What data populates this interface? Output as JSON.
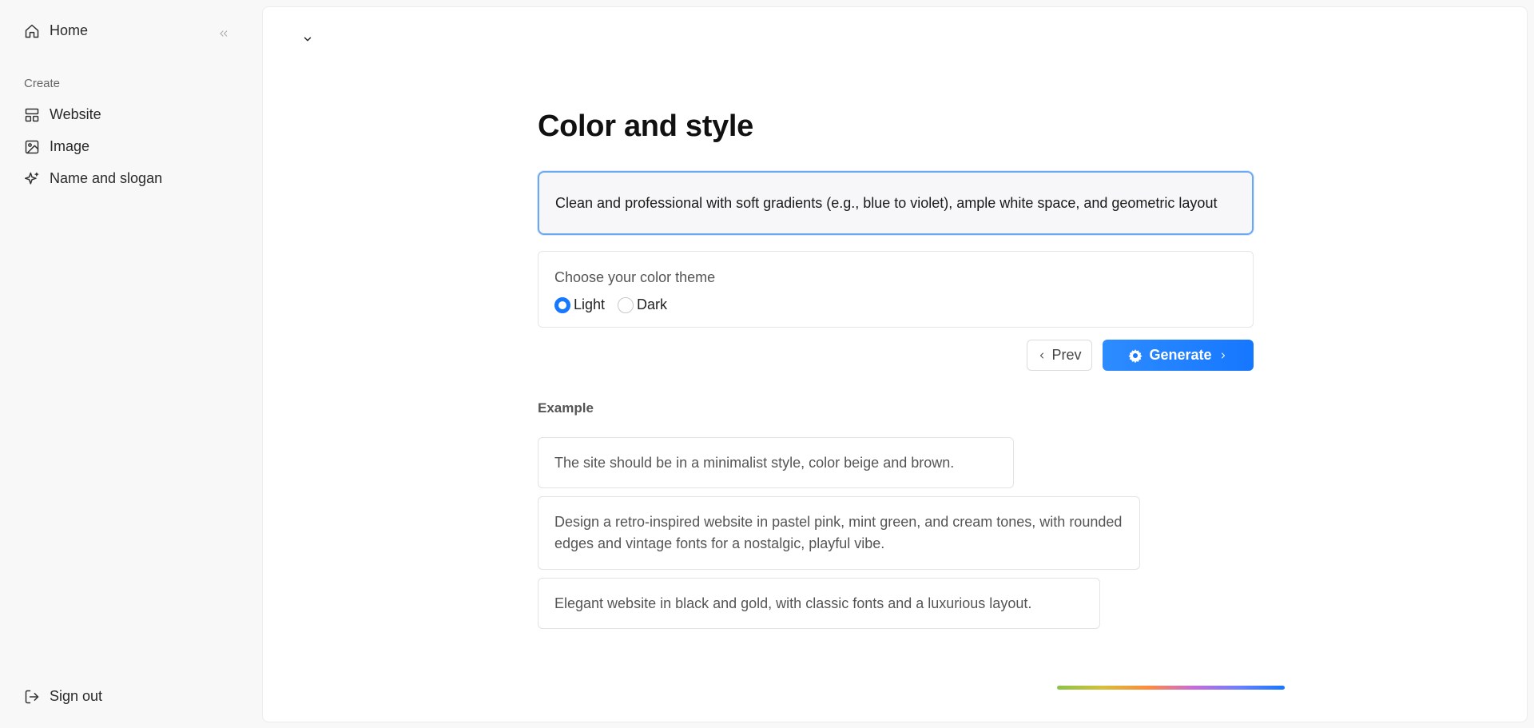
{
  "sidebar": {
    "home_label": "Home",
    "create_section_label": "Create",
    "items": [
      {
        "label": "Website",
        "icon": "layout-icon"
      },
      {
        "label": "Image",
        "icon": "image-icon"
      },
      {
        "label": "Name and slogan",
        "icon": "sparkles-icon"
      }
    ],
    "signout_label": "Sign out"
  },
  "main": {
    "title": "Color and style",
    "prompt_value": "Clean and professional with soft gradients (e.g., blue to violet), ample white space, and geometric layout",
    "theme": {
      "label": "Choose your color theme",
      "options": [
        "Light",
        "Dark"
      ],
      "selected": "Light"
    },
    "prev_label": "Prev",
    "generate_label": "Generate",
    "example_label": "Example",
    "examples": [
      "The site should be in a minimalist style, color beige and brown.",
      "Design a retro-inspired website in pastel pink, mint green, and cream tones, with rounded edges and vintage fonts for a nostalgic, playful vibe.",
      "Elegant website in black and gold, with classic fonts and a luxurious layout."
    ]
  },
  "colors": {
    "accent": "#1677ff",
    "input_border": "#6aa8f0",
    "progress_gradient": [
      "#8bc34a",
      "#d4c03a",
      "#ff8a3d",
      "#c86bd9",
      "#6b7fff",
      "#1677ff"
    ]
  }
}
